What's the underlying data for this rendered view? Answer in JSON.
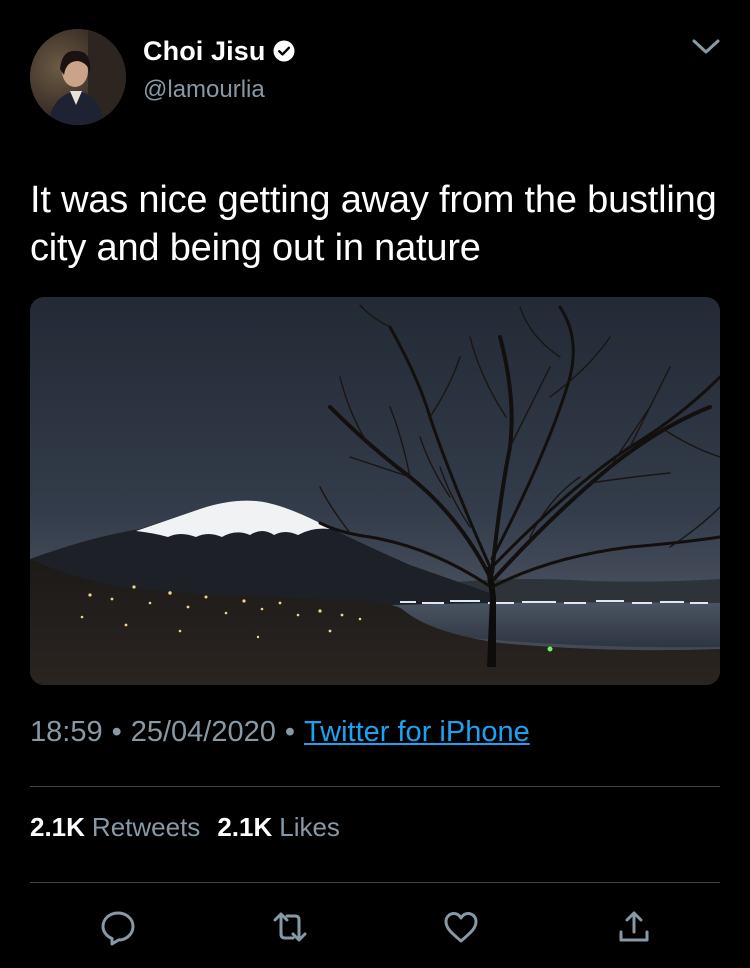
{
  "author": {
    "display_name": "Choi Jisu",
    "handle": "@lamourlia",
    "verified": true
  },
  "tweet": {
    "text": "It was nice getting away from the bustling city and being out in nature",
    "time": "18:59",
    "date": "25/04/2020",
    "separator": "•",
    "source": "Twitter for iPhone"
  },
  "stats": {
    "retweets_count": "2.1K",
    "retweets_label": "Retweets",
    "likes_count": "2.1K",
    "likes_label": "Likes"
  },
  "actions": [
    "reply-icon",
    "retweet-icon",
    "like-icon",
    "share-icon"
  ],
  "colors": {
    "background": "#000000",
    "text_primary": "#ffffff",
    "text_secondary": "#8899a6",
    "link": "#1da1f2",
    "divider": "#38444d"
  }
}
